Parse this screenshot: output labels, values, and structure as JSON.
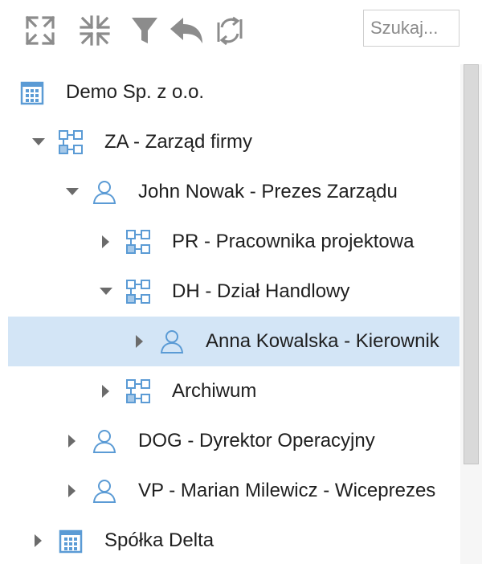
{
  "toolbar": {
    "expand_all_icon": "expand-all-icon",
    "collapse_all_icon": "collapse-all-icon",
    "filter_icon": "filter-icon",
    "undo_icon": "undo-icon",
    "refresh_icon": "refresh-sync-icon",
    "search_placeholder": "Szukaj..."
  },
  "colors": {
    "icon_gray": "#8c8c8c",
    "org_icon_blue": "#5b9bd5",
    "selected_row": "#d3e5f6",
    "toggle_gray": "#6b6b6b"
  },
  "tree": [
    {
      "label": "Demo Sp. z o.o.",
      "type": "company",
      "level": 0,
      "state": "none",
      "selected": false
    },
    {
      "label": "ZA - Zarząd firmy",
      "type": "department",
      "level": 0,
      "state": "expanded",
      "selected": false
    },
    {
      "label": "John Nowak - Prezes Zarządu",
      "type": "person",
      "level": 1,
      "state": "expanded",
      "selected": false
    },
    {
      "label": "PR - Pracownika projektowa",
      "type": "department",
      "level": 2,
      "state": "collapsed",
      "selected": false
    },
    {
      "label": "DH - Dział Handlowy",
      "type": "department",
      "level": 2,
      "state": "expanded",
      "selected": false
    },
    {
      "label": "Anna Kowalska - Kierownik",
      "type": "person",
      "level": 3,
      "state": "collapsed",
      "selected": true
    },
    {
      "label": "Archiwum",
      "type": "department",
      "level": 2,
      "state": "collapsed",
      "selected": false
    },
    {
      "label": "DOG - Dyrektor Operacyjny",
      "type": "person",
      "level": 1,
      "state": "collapsed",
      "selected": false
    },
    {
      "label": "VP - Marian Milewicz - Wiceprezes",
      "type": "person",
      "level": 1,
      "state": "collapsed",
      "selected": false
    },
    {
      "label": "Spółka Delta",
      "type": "company",
      "level": 0,
      "state": "collapsed",
      "selected": false
    }
  ]
}
